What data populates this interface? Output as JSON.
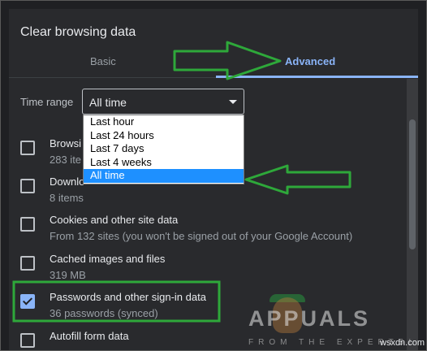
{
  "dialog": {
    "title": "Clear browsing data"
  },
  "tabs": [
    {
      "label": "Basic",
      "active": false
    },
    {
      "label": "Advanced",
      "active": true
    }
  ],
  "time_range": {
    "label": "Time range",
    "value": "All time",
    "options": [
      "Last hour",
      "Last 24 hours",
      "Last 7 days",
      "Last 4 weeks",
      "All time"
    ],
    "selected_option": "All time"
  },
  "items": [
    {
      "title": "Browsing history",
      "title_visible": "Browsi",
      "subtitle_visible": "283 ite",
      "checked": false
    },
    {
      "title": "Download history",
      "title_visible": "Downlo",
      "subtitle_visible": "8 items",
      "checked": false
    },
    {
      "title": "Cookies and other site data",
      "title_visible": "Cookies and other site data",
      "subtitle_visible": "From 132 sites (you won't be signed out of your Google Account)",
      "checked": false
    },
    {
      "title": "Cached images and files",
      "title_visible": "Cached images and files",
      "subtitle_visible": "319 MB",
      "checked": false
    },
    {
      "title": "Passwords and other sign-in data",
      "title_visible": "Passwords and other sign-in data",
      "subtitle_visible": "36 passwords (synced)",
      "checked": true
    },
    {
      "title": "Autofill form data",
      "title_visible": "Autofill form data",
      "subtitle_visible": "",
      "checked": false
    }
  ],
  "watermark": {
    "brand": "APPUALS",
    "tagline": "FROM THE EXPERTS!",
    "site": "wsxdn.com"
  },
  "colors": {
    "dialog_bg": "#292a2d",
    "accent": "#8ab4f8",
    "annotation_green": "#2ea83a",
    "dropdown_highlight": "#1e90ff"
  }
}
